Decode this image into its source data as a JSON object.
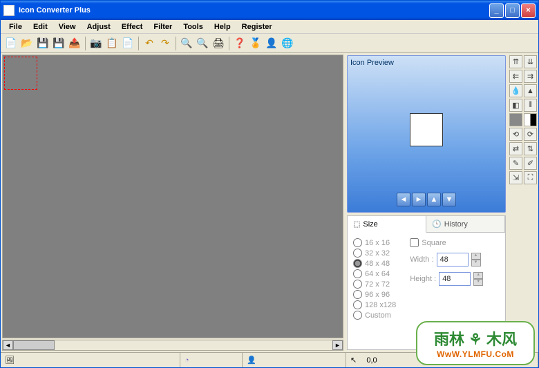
{
  "window": {
    "title": "Icon Converter Plus"
  },
  "menu": [
    "File",
    "Edit",
    "View",
    "Adjust",
    "Effect",
    "Filter",
    "Tools",
    "Help",
    "Register"
  ],
  "status": {
    "coord": "0,0"
  },
  "preview": {
    "title": "Icon Preview"
  },
  "tabs": {
    "size": "Size",
    "history": "History"
  },
  "sizes": [
    "16 x 16",
    "32 x 32",
    "48 x 48",
    "64 x 64",
    "72 x 72",
    "96 x 96",
    "128 x128",
    "Custom"
  ],
  "size_selected": 2,
  "square_label": "Square",
  "width_label": "Width :",
  "height_label": "Height :",
  "width_val": "48",
  "height_val": "48",
  "watermark": {
    "line1": "雨林 ⚘ 木风",
    "line2": "WwW.YLMFU.CoM"
  }
}
